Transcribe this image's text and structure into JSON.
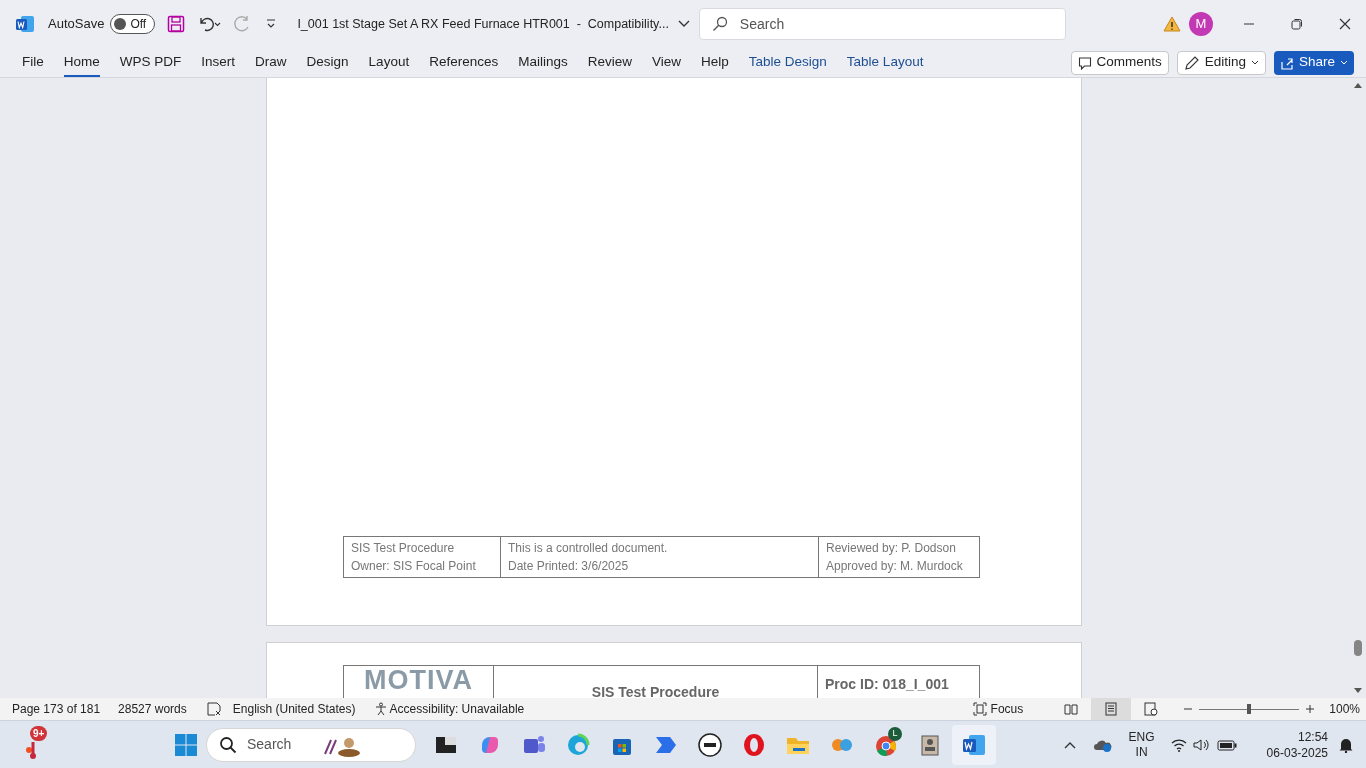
{
  "title_bar": {
    "autosave_label": "AutoSave",
    "autosave_on": false,
    "autosave_state": "Off",
    "document_title": "I_001 1st Stage Set A RX Feed Furnace HTR001  -  Compatibility...",
    "search_placeholder": "Search",
    "avatar_initial": "M"
  },
  "ribbon_tabs": [
    {
      "label": "File",
      "selected": false,
      "kind": "plain"
    },
    {
      "label": "Home",
      "selected": true,
      "kind": "plain"
    },
    {
      "label": "WPS PDF",
      "selected": false,
      "kind": "plain"
    },
    {
      "label": "Insert",
      "selected": false,
      "kind": "plain"
    },
    {
      "label": "Draw",
      "selected": false,
      "kind": "plain"
    },
    {
      "label": "Design",
      "selected": false,
      "kind": "plain"
    },
    {
      "label": "Layout",
      "selected": false,
      "kind": "plain"
    },
    {
      "label": "References",
      "selected": false,
      "kind": "plain"
    },
    {
      "label": "Mailings",
      "selected": false,
      "kind": "plain"
    },
    {
      "label": "Review",
      "selected": false,
      "kind": "plain"
    },
    {
      "label": "View",
      "selected": false,
      "kind": "plain"
    },
    {
      "label": "Help",
      "selected": false,
      "kind": "plain"
    },
    {
      "label": "Table Design",
      "selected": false,
      "kind": "contextual"
    },
    {
      "label": "Table Layout",
      "selected": false,
      "kind": "contextual"
    }
  ],
  "ribbon_buttons": {
    "comments": "Comments",
    "editing": "Editing",
    "share": "Share"
  },
  "footer_table": [
    [
      "SIS Test Procedure",
      "Owner: SIS Focal Point"
    ],
    [
      "This is a controlled document.",
      "Date Printed: 3/6/2025"
    ],
    [
      "Reviewed by: P. Dodson",
      "Approved by: M. Murdock"
    ]
  ],
  "next_page_header": {
    "logo_text": "MOTIVA",
    "title": "SIS Test Procedure",
    "proc_id": "Proc ID: 018_I_001"
  },
  "status_bar": {
    "page": "Page 173 of 181",
    "words": "28527 words",
    "language": "English (United States)",
    "accessibility": "Accessibility: Unavailable",
    "focus": "Focus",
    "level": 0.5,
    "zoom": "100%",
    "views": [
      {
        "kind": "read",
        "selected": false
      },
      {
        "kind": "print",
        "selected": true
      },
      {
        "kind": "web",
        "selected": false
      }
    ]
  },
  "taskbar": {
    "badge": "9+",
    "search": "Search",
    "language": "ENG",
    "region": "IN",
    "time": "12:54",
    "date": "06-03-2025",
    "chrome_badge": "L"
  }
}
